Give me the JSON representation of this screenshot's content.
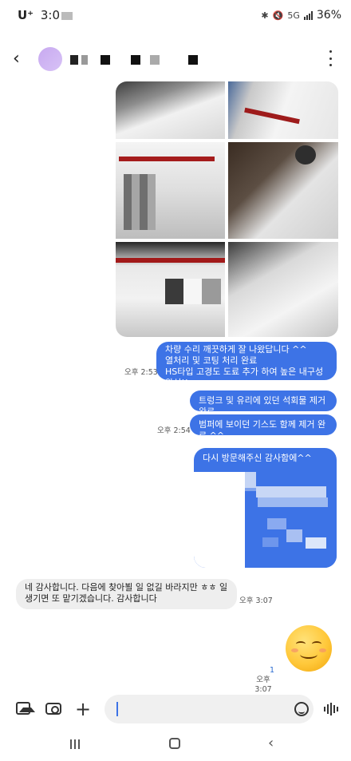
{
  "status_bar": {
    "carrier": "U⁺",
    "time": "3:0",
    "battery": "36%",
    "network": "5G"
  },
  "header": {
    "back_icon": "chevron-left-icon",
    "menu_icon": "more-vertical-icon"
  },
  "messages": [
    {
      "direction": "sent",
      "lines": [
        "차량 수리 깨끗하게 잘 나왔답니다 ^^",
        "열처리 및 코팅 처리 완료",
        "HS타입 고경도 도료 추가 하여 높은 내구성 완성!!"
      ],
      "time": "오후 2:53"
    },
    {
      "direction": "sent",
      "lines": [
        "트렁크 및 유리에 있던 석회물 제거 완료"
      ],
      "time": ""
    },
    {
      "direction": "sent",
      "lines": [
        "범퍼에 보이던 기스도 함께 제거 완료.^^"
      ],
      "time": "오후 2:54"
    },
    {
      "direction": "sent",
      "lines": [
        "다시 방문해주신 감사함에^^"
      ],
      "time": ""
    },
    {
      "direction": "received",
      "lines": [
        "네 감사합니다. 다음에 찾아뵐 일 없길 바라지만 ㅎㅎ 일",
        "생기면 또 맡기겠습니다. 감사합니다"
      ],
      "time": "오후 3:07"
    },
    {
      "direction": "sent",
      "lines": [],
      "emoji": "smiling-face-emoji",
      "unread": "1",
      "time": "오후 3:07"
    }
  ],
  "input_bar": {
    "gallery_icon": "gallery-icon",
    "camera_icon": "camera-icon",
    "plus_icon": "plus-icon",
    "emoji_icon": "smile-icon",
    "voice_icon": "voice-icon"
  },
  "nav_bar": {
    "recent": "recent-apps-icon",
    "home": "home-icon",
    "back": "back-icon"
  },
  "colors": {
    "sent_bubble": "#3d73e6",
    "received_bubble": "#eeeeee",
    "unread_count": "#2a6bd1"
  }
}
